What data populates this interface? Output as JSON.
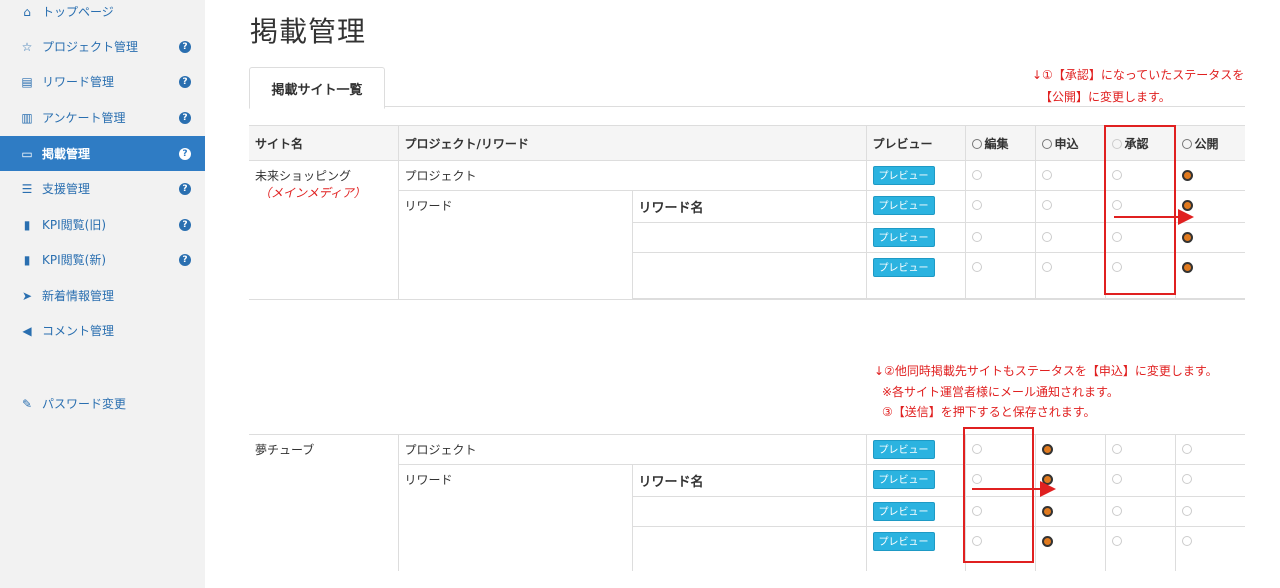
{
  "sidebar": {
    "items": [
      {
        "icon": "home-icon",
        "glyph": "⌂",
        "label": "トップページ",
        "help": false,
        "active": false
      },
      {
        "icon": "star-icon",
        "glyph": "☆",
        "label": "プロジェクト管理",
        "help": true,
        "active": false
      },
      {
        "icon": "gift-icon",
        "glyph": "▤",
        "label": "リワード管理",
        "help": true,
        "active": false
      },
      {
        "icon": "list-icon",
        "glyph": "▥",
        "label": "アンケート管理",
        "help": true,
        "active": false
      },
      {
        "icon": "monitor-icon",
        "glyph": "▭",
        "label": "掲載管理",
        "help": true,
        "active": true
      },
      {
        "icon": "list-icon",
        "glyph": "☰",
        "label": "支援管理",
        "help": true,
        "active": false
      },
      {
        "icon": "bar-chart-icon",
        "glyph": "▮",
        "label": "KPI閲覧(旧)",
        "help": true,
        "active": false
      },
      {
        "icon": "bar-chart-icon",
        "glyph": "▮",
        "label": "KPI閲覧(新)",
        "help": true,
        "active": false
      },
      {
        "icon": "send-icon",
        "glyph": "➤",
        "label": "新着情報管理",
        "help": false,
        "active": false
      },
      {
        "icon": "megaphone-icon",
        "glyph": "◀",
        "label": "コメント管理",
        "help": false,
        "active": false
      },
      {
        "icon": "wrench-icon",
        "glyph": "✎",
        "label": "パスワード変更",
        "help": false,
        "active": false
      }
    ],
    "help_glyph": "?"
  },
  "page_title": "掲載管理",
  "tab_label": "掲載サイト一覧",
  "table": {
    "headers": {
      "site": "サイト名",
      "project": "プロジェクト/リワード",
      "preview": "プレビュー",
      "edit": "編集",
      "apply": "申込",
      "approve": "承認",
      "publish": "公開"
    },
    "preview_label": "プレビュー",
    "sites": [
      {
        "name": "未来ショッピング",
        "sub": "（メインメディア）",
        "project_label": "プロジェクト",
        "reward_label": "リワード",
        "reward_name": "リワード名",
        "status_rows": [
          "publish",
          "publish",
          "publish",
          "publish"
        ]
      },
      {
        "name": "夢チューブ",
        "sub": "",
        "project_label": "プロジェクト",
        "reward_label": "リワード",
        "reward_name": "リワード名",
        "status_rows": [
          "apply",
          "apply",
          "apply",
          "apply"
        ]
      }
    ]
  },
  "notes": {
    "note1_line1": "↓①【承認】になっていたステータスを",
    "note1_line2": "【公開】に変更します。",
    "note2_line1": "↓②他同時掲載先サイトもステータスを【申込】に変更します。",
    "note2_line2": "※各サイト運営者様にメール通知されます。",
    "note2_line3": "③【送信】を押下すると保存されます。"
  },
  "colors": {
    "accent": "#2f7cc4",
    "preview_btn": "#2bb3e0",
    "selected_radio": "#e07a1f",
    "annotation": "#e02020"
  }
}
